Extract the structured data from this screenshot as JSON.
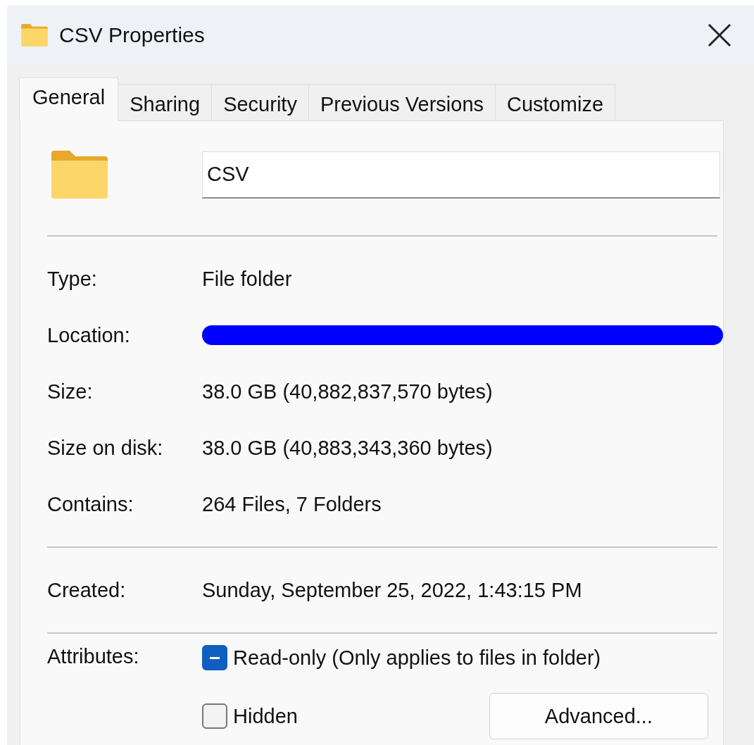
{
  "window": {
    "title": "CSV Properties"
  },
  "tabs": [
    {
      "label": "General",
      "selected": true
    },
    {
      "label": "Sharing",
      "selected": false
    },
    {
      "label": "Security",
      "selected": false
    },
    {
      "label": "Previous Versions",
      "selected": false
    },
    {
      "label": "Customize",
      "selected": false
    }
  ],
  "name_field": {
    "value": "CSV"
  },
  "groups": [
    [
      {
        "label": "Type:",
        "value": "File folder"
      },
      {
        "label": "Location:",
        "redacted": true
      },
      {
        "label": "Size:",
        "value": "38.0 GB (40,882,837,570 bytes)"
      },
      {
        "label": "Size on disk:",
        "value": "38.0 GB (40,883,343,360 bytes)"
      },
      {
        "label": "Contains:",
        "value": "264 Files, 7 Folders"
      }
    ],
    [
      {
        "label": "Created:",
        "value": "Sunday, September 25, 2022, 1:43:15 PM"
      }
    ]
  ],
  "attributes": {
    "label": "Attributes:",
    "options": [
      {
        "label": "Read-only (Only applies to files in folder)",
        "indeterminate": true
      },
      {
        "label": "Hidden",
        "indeterminate": false
      }
    ],
    "button": "Advanced..."
  }
}
